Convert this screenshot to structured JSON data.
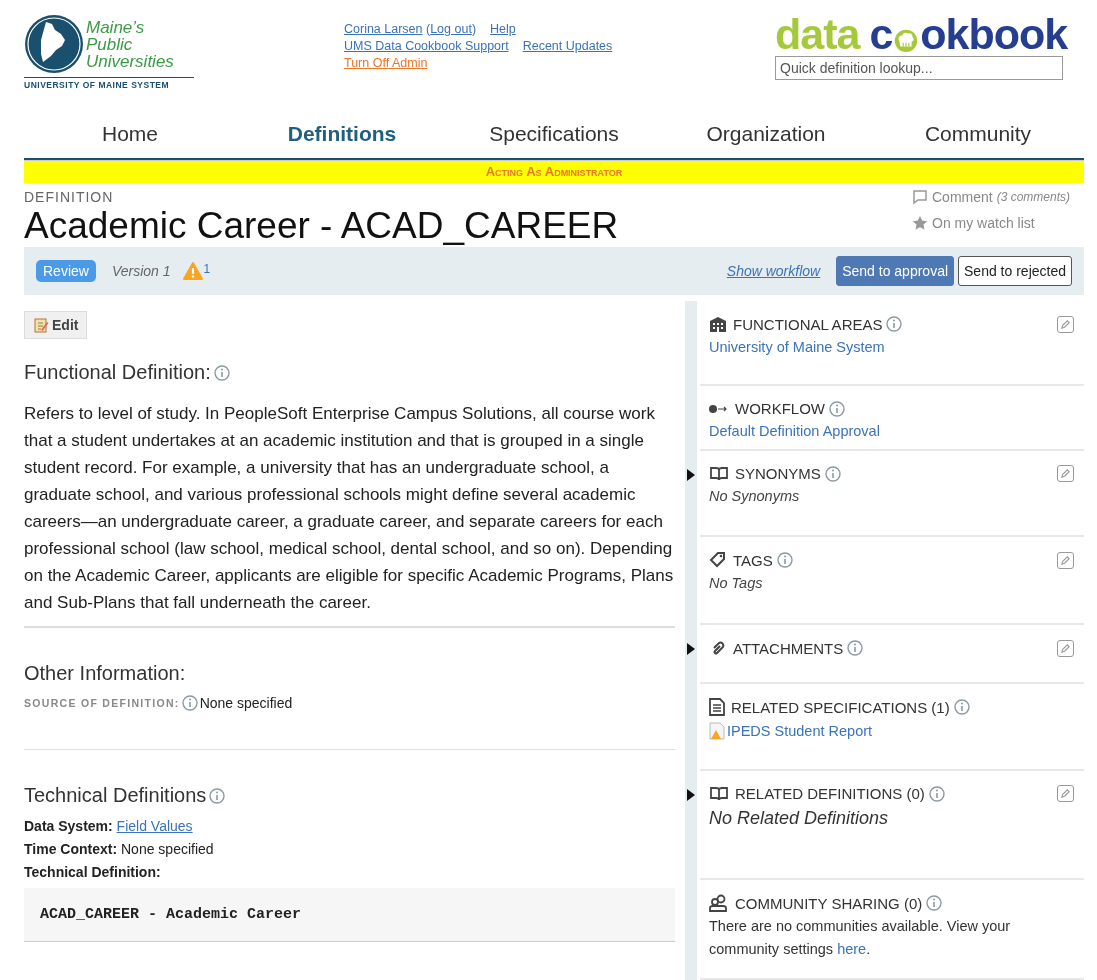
{
  "header": {
    "org_logo": {
      "name_lines": [
        "Maine’s",
        "Public",
        "Universities"
      ],
      "system": "UNIVERSITY OF MAINE SYSTEM"
    },
    "user_links": {
      "user": "Corina Larsen",
      "logout_open": "(",
      "logout": "Log out",
      "logout_close": ")",
      "help": "Help",
      "support": "UMS Data Cookbook Support",
      "updates": "Recent Updates",
      "admin": "Turn Off Admin"
    },
    "product_logo": {
      "first": "data",
      "second_start": "c",
      "second_end": "okbook"
    },
    "search": {
      "placeholder": "Quick definition lookup..."
    }
  },
  "nav": [
    {
      "label": "Home",
      "selected": false
    },
    {
      "label": "Definitions",
      "selected": true
    },
    {
      "label": "Specifications",
      "selected": false
    },
    {
      "label": "Organization",
      "selected": false
    },
    {
      "label": "Community",
      "selected": false
    }
  ],
  "banner": "Acting As Administrator",
  "page": {
    "kicker": "DEFINITION",
    "title": "Academic Career - ACAD_CAREER",
    "comment": "Comment",
    "comment_count": "(3 comments)",
    "watch": "On my watch list"
  },
  "review_bar": {
    "status": "Review",
    "version": "Version 1",
    "warnings": "1",
    "show_workflow": "Show workflow",
    "approve": "Send to approval",
    "reject": "Send to rejected"
  },
  "main": {
    "edit": "Edit",
    "functional_heading": "Functional Definition:",
    "functional_text": "Refers to level of study. In PeopleSoft Enterprise Campus Solutions, all course work that a student undertakes at an academic institution and that is grouped in a single student record. For example, a university that has an undergraduate school, a graduate school, and various professional schools might define several academic careers—an undergraduate career, a graduate career, and separate careers for each professional school (law school, medical school, dental school, and so on). Depending on the Academic Career, applicants are eligible for specific Academic Programs, Plans and Sub-Plans that fall underneath the career.",
    "other_heading": "Other Information:",
    "source_label": "SOURCE OF DEFINITION:",
    "source_value": "None specified",
    "technical_heading": "Technical Definitions",
    "technical_rows": [
      {
        "label": "Data System:",
        "value": "Field Values",
        "kind": "link"
      },
      {
        "label": "Time Context:",
        "value": "None specified",
        "kind": "text"
      },
      {
        "label": "Technical Definition:",
        "kind": "label"
      }
    ],
    "code": "ACAD_CAREER - Academic Career"
  },
  "sidebar": [
    {
      "title": "FUNCTIONAL AREAS",
      "edit": true,
      "toggle": false,
      "content": {
        "kind": "link",
        "text": "University of Maine System"
      }
    },
    {
      "title": "WORKFLOW",
      "edit": false,
      "toggle": false,
      "content": {
        "kind": "link",
        "text": "Default Definition Approval"
      }
    },
    {
      "title": "SYNONYMS",
      "edit": true,
      "toggle": true,
      "content": {
        "kind": "empty",
        "text": "No Synonyms"
      }
    },
    {
      "title": "TAGS",
      "edit": true,
      "toggle": false,
      "content": {
        "kind": "empty",
        "text": "No Tags"
      }
    },
    {
      "title": "ATTACHMENTS",
      "edit": true,
      "toggle": true
    },
    {
      "title": "RELATED SPECIFICATIONS (1)",
      "edit": false,
      "toggle": false,
      "content": {
        "kind": "spec",
        "text": "IPEDS Student Report"
      }
    },
    {
      "title": "RELATED DEFINITIONS (0)",
      "edit": true,
      "toggle": true,
      "content": {
        "kind": "empty_large",
        "text": "No Related Definitions"
      }
    },
    {
      "title": "COMMUNITY SHARING (0)",
      "edit": false,
      "toggle": false,
      "content": {
        "kind": "sentence",
        "text": "There are no communities available. View your community settings ",
        "link": "here",
        "after": "."
      }
    }
  ]
}
